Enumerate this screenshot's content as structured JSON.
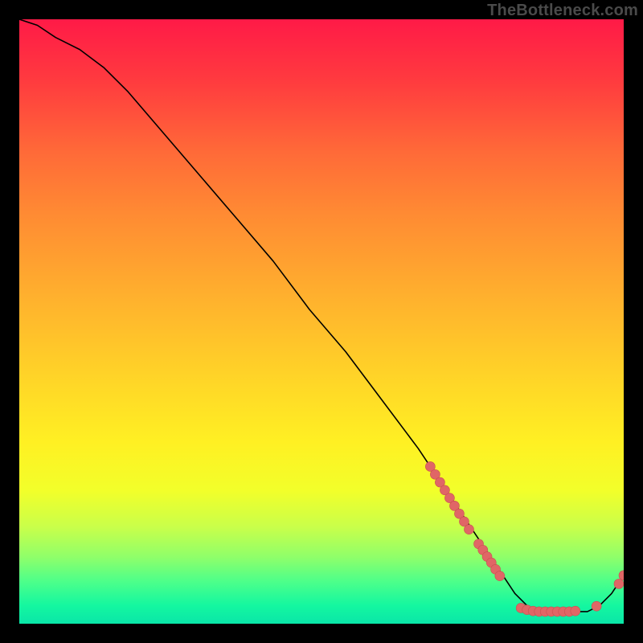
{
  "watermark": "TheBottleneck.com",
  "colors": {
    "curve": "#000000",
    "marker_fill": "#e06666",
    "marker_stroke": "#c94f4f",
    "gradient_top": "#ff1a47",
    "gradient_bottom": "#0ae6a8",
    "page_bg": "#000000"
  },
  "chart_data": {
    "type": "line",
    "title": "",
    "xlabel": "",
    "ylabel": "",
    "xlim": [
      0,
      100
    ],
    "ylim": [
      0,
      100
    ],
    "grid": false,
    "legend": false,
    "series": [
      {
        "name": "bottleneck-curve",
        "x": [
          0,
          3,
          6,
          10,
          14,
          18,
          24,
          30,
          36,
          42,
          48,
          54,
          60,
          66,
          70,
          72,
          74,
          76,
          78,
          80,
          82,
          84,
          86,
          88,
          90,
          92,
          94,
          96,
          98,
          100
        ],
        "y": [
          100,
          99,
          97,
          95,
          92,
          88,
          81,
          74,
          67,
          60,
          52,
          45,
          37,
          29,
          23,
          20,
          17,
          14,
          11,
          8,
          5,
          3,
          2,
          2,
          2,
          2,
          2,
          3,
          5,
          8
        ]
      }
    ],
    "markers": [
      {
        "name": "cluster-a",
        "points": [
          {
            "x": 68.0,
            "y": 26.0
          },
          {
            "x": 68.8,
            "y": 24.7
          },
          {
            "x": 69.6,
            "y": 23.4
          },
          {
            "x": 70.4,
            "y": 22.1
          },
          {
            "x": 71.2,
            "y": 20.8
          },
          {
            "x": 72.0,
            "y": 19.5
          },
          {
            "x": 72.8,
            "y": 18.2
          },
          {
            "x": 73.6,
            "y": 16.9
          },
          {
            "x": 74.4,
            "y": 15.6
          }
        ]
      },
      {
        "name": "cluster-b",
        "points": [
          {
            "x": 76.0,
            "y": 13.2
          },
          {
            "x": 76.7,
            "y": 12.2
          },
          {
            "x": 77.4,
            "y": 11.1
          },
          {
            "x": 78.1,
            "y": 10.1
          },
          {
            "x": 78.8,
            "y": 9.0
          },
          {
            "x": 79.5,
            "y": 7.9
          }
        ]
      },
      {
        "name": "cluster-c",
        "points": [
          {
            "x": 83.0,
            "y": 2.6
          },
          {
            "x": 84.0,
            "y": 2.3
          },
          {
            "x": 85.0,
            "y": 2.1
          },
          {
            "x": 86.0,
            "y": 2.0
          },
          {
            "x": 87.0,
            "y": 2.0
          },
          {
            "x": 88.0,
            "y": 2.0
          },
          {
            "x": 89.0,
            "y": 2.0
          },
          {
            "x": 90.0,
            "y": 2.0
          },
          {
            "x": 91.0,
            "y": 2.0
          },
          {
            "x": 92.0,
            "y": 2.1
          }
        ]
      },
      {
        "name": "cluster-d",
        "points": [
          {
            "x": 95.5,
            "y": 2.9
          }
        ]
      },
      {
        "name": "cluster-e",
        "points": [
          {
            "x": 99.2,
            "y": 6.6
          },
          {
            "x": 100.0,
            "y": 8.0
          }
        ]
      }
    ]
  }
}
